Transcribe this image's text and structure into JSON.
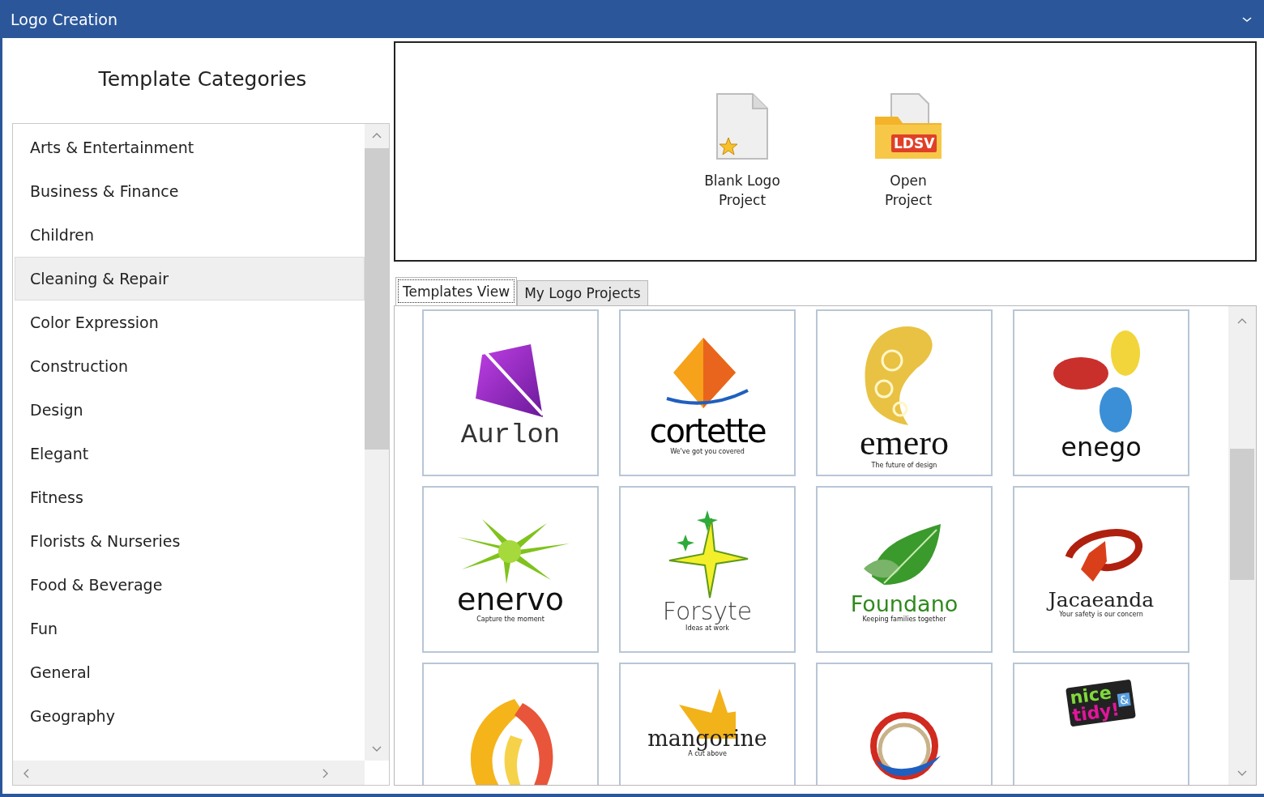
{
  "window": {
    "title": "Logo Creation"
  },
  "sidebar": {
    "heading": "Template Categories",
    "items": [
      {
        "label": "Arts & Entertainment",
        "selected": false
      },
      {
        "label": "Business & Finance",
        "selected": false
      },
      {
        "label": "Children",
        "selected": false
      },
      {
        "label": "Cleaning & Repair",
        "selected": true
      },
      {
        "label": "Color Expression",
        "selected": false
      },
      {
        "label": "Construction",
        "selected": false
      },
      {
        "label": "Design",
        "selected": false
      },
      {
        "label": "Elegant",
        "selected": false
      },
      {
        "label": "Fitness",
        "selected": false
      },
      {
        "label": "Florists & Nurseries",
        "selected": false
      },
      {
        "label": "Food & Beverage",
        "selected": false
      },
      {
        "label": "Fun",
        "selected": false
      },
      {
        "label": "General",
        "selected": false
      },
      {
        "label": "Geography",
        "selected": false
      }
    ]
  },
  "actions": [
    {
      "kind": "blank",
      "label": "Blank Logo Project"
    },
    {
      "kind": "open",
      "label": "Open Project",
      "icon_label": "LDSV"
    }
  ],
  "tabs": [
    {
      "label": "Templates View",
      "selected": true
    },
    {
      "label": "My Logo Projects",
      "selected": false
    }
  ],
  "templates": [
    {
      "kind": "kite",
      "name": "Aurlon"
    },
    {
      "kind": "diamond",
      "name": "cortette",
      "tagline": "We've got you covered"
    },
    {
      "kind": "shell",
      "name": "emero",
      "tagline": "The future of design"
    },
    {
      "kind": "petals",
      "name": "enego"
    },
    {
      "kind": "burst",
      "name": "enervo",
      "tagline": "Capture the moment"
    },
    {
      "kind": "stars",
      "name": "Forsyte",
      "tagline": "Ideas at work"
    },
    {
      "kind": "leaf",
      "name": "Foundano",
      "tagline": "Keeping families together"
    },
    {
      "kind": "swoosh",
      "name": "Jacaeanda",
      "tagline": "Your safety is our concern"
    },
    {
      "kind": "flame"
    },
    {
      "kind": "star",
      "name": "mangorine",
      "tagline": "A cut above"
    },
    {
      "kind": "ring"
    },
    {
      "kind": "badge",
      "name": "nice",
      "mark": "&",
      "name2": "tidy!"
    }
  ]
}
